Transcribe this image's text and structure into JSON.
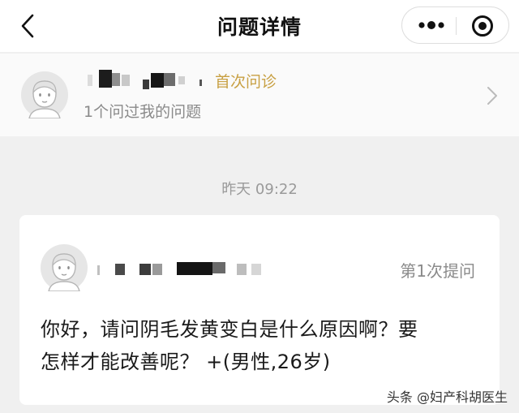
{
  "nav": {
    "title": "问题详情",
    "back_icon": "chevron-left-icon",
    "more_icon": "more-dots-icon",
    "close_icon": "target-circle-icon"
  },
  "doctor": {
    "badge": "首次问诊",
    "subtitle": "1个问过我的问题",
    "avatar_icon": "user-avatar-icon"
  },
  "conversation": {
    "timestamp": "昨天 09:22"
  },
  "question": {
    "ask_count": "第1次提问",
    "text_line1": "你好，请问阴毛发黄变白是什么原因啊？要",
    "text_line2": "怎样才能改善呢？ +(男性,26岁)"
  },
  "watermark": "头条 @妇产科胡医生",
  "colors": {
    "badge": "#c8a043",
    "muted": "#8a8a8a",
    "background": "#f0f0f0"
  }
}
